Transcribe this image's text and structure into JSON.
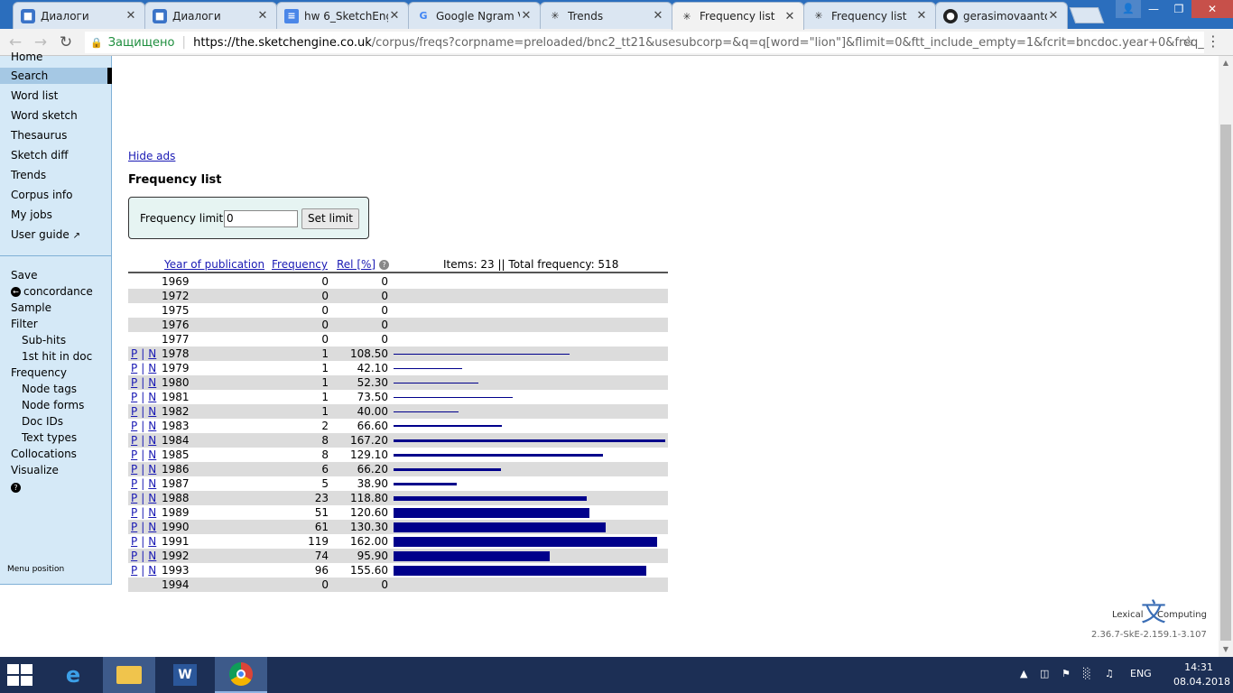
{
  "browser": {
    "tabs": [
      {
        "title": "Диалоги",
        "icon": "chat-icon",
        "active": false
      },
      {
        "title": "Диалоги",
        "icon": "chat-icon",
        "active": false
      },
      {
        "title": "hw 6_SketchEng",
        "icon": "docs-icon",
        "active": false
      },
      {
        "title": "Google Ngram V",
        "icon": "google-icon",
        "active": false
      },
      {
        "title": "Trends",
        "icon": "sketchengine-icon",
        "active": false
      },
      {
        "title": "Frequency list",
        "icon": "sketchengine-icon",
        "active": true
      },
      {
        "title": "Frequency list",
        "icon": "sketchengine-icon",
        "active": false
      },
      {
        "title": "gerasimovaanto",
        "icon": "github-icon",
        "active": false
      }
    ],
    "secure_label": "Защищено",
    "url_host": "https://the.sketchengine.co.uk",
    "url_rest": "/corpus/freqs?corpname=preloaded/bnc2_tt21&usesubcorp=&q=q[word=\"lion\"]&flimit=0&ftt_include_empty=1&fcrit=bncdoc.year+0&freq_so..."
  },
  "sidebar": {
    "items": [
      {
        "label": "Home"
      },
      {
        "label": "Search",
        "active": true
      },
      {
        "label": "Word list"
      },
      {
        "label": "Word sketch"
      },
      {
        "label": "Thesaurus"
      },
      {
        "label": "Sketch diff"
      },
      {
        "label": "Trends"
      },
      {
        "label": "Corpus info"
      },
      {
        "label": "My jobs"
      },
      {
        "label": "User guide"
      }
    ],
    "actions": [
      {
        "label": "Save"
      },
      {
        "label": "concordance"
      },
      {
        "label": "Sample"
      },
      {
        "label": "Filter"
      },
      {
        "label": "Sub-hits"
      },
      {
        "label": "1st hit in doc"
      },
      {
        "label": "Frequency"
      },
      {
        "label": "Node tags"
      },
      {
        "label": "Node forms"
      },
      {
        "label": "Doc IDs"
      },
      {
        "label": "Text types"
      },
      {
        "label": "Collocations"
      },
      {
        "label": "Visualize"
      }
    ],
    "menu_position": "Menu position"
  },
  "main": {
    "hide_ads": "Hide ads",
    "title": "Frequency list",
    "limit_label": "Frequency limit:",
    "limit_value": "0",
    "set_limit": "Set limit",
    "col_year": "Year of publication",
    "col_freq": "Frequency",
    "col_rel": "Rel [%]",
    "summary": "Items: 23 || Total frequency: 518",
    "pn_p": "P",
    "pn_sep": "|",
    "pn_n": "N"
  },
  "chart_data": {
    "type": "bar",
    "categories": [
      "1969",
      "1972",
      "1975",
      "1976",
      "1977",
      "1978",
      "1979",
      "1980",
      "1981",
      "1982",
      "1983",
      "1984",
      "1985",
      "1986",
      "1987",
      "1988",
      "1989",
      "1990",
      "1991",
      "1992",
      "1993",
      "1994"
    ],
    "series": [
      {
        "name": "Frequency",
        "values": [
          0,
          0,
          0,
          0,
          0,
          1,
          1,
          1,
          1,
          1,
          2,
          8,
          8,
          6,
          5,
          23,
          51,
          61,
          119,
          74,
          96,
          0
        ]
      },
      {
        "name": "Rel [%]",
        "values": [
          "0",
          "0",
          "0",
          "0",
          "0",
          "108.50",
          "42.10",
          "52.30",
          "73.50",
          "40.00",
          "66.60",
          "167.20",
          "129.10",
          "66.20",
          "38.90",
          "118.80",
          "120.60",
          "130.30",
          "162.00",
          "95.90",
          "155.60",
          "0"
        ]
      }
    ],
    "xlabel": "Year of publication",
    "ylabel": "Rel [%]"
  },
  "footer": {
    "logo_left": "Lexical",
    "logo_right": "Computing",
    "version": "2.36.7-SkE-2.159.1-3.107"
  },
  "taskbar": {
    "lang": "ENG",
    "time": "14:31",
    "date": "08.04.2018"
  },
  "colors": {
    "bar": "#00008b",
    "sidebar": "#d5e9f7",
    "sidebar_active": "#a5c8e4",
    "link": "#1a1ab4"
  }
}
